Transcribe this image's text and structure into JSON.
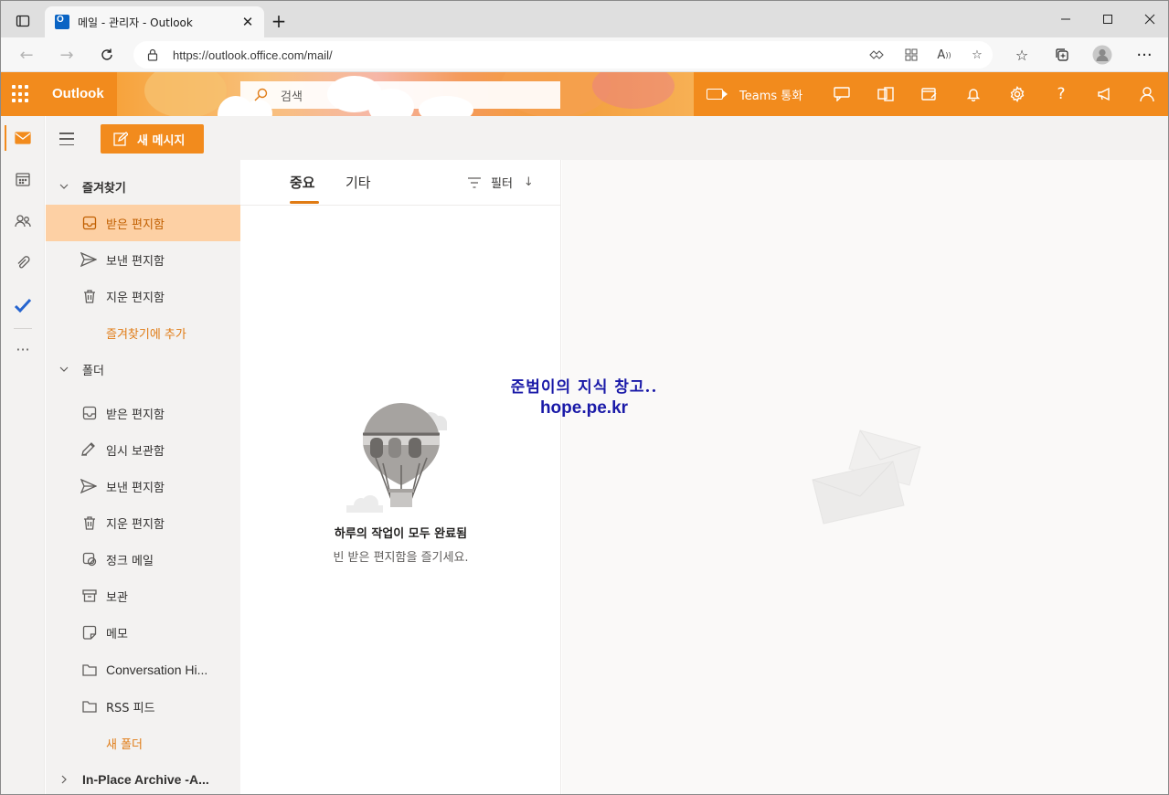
{
  "browser": {
    "tab_title": "메일 - 관리자 - Outlook",
    "url": "https://outlook.office.com/mail/"
  },
  "outlook": {
    "brand": "Outlook",
    "search_placeholder": "검색",
    "teams_label": "Teams 통화",
    "new_message_label": "새 메시지",
    "accent_color": "#f28b1d"
  },
  "folders": {
    "favorites_header": "즐겨찾기",
    "favorites": [
      {
        "label": "받은 편지함",
        "icon": "inbox-icon"
      },
      {
        "label": "보낸 편지함",
        "icon": "send-icon"
      },
      {
        "label": "지운 편지함",
        "icon": "trash-icon"
      }
    ],
    "add_favorite": "즐겨찾기에 추가",
    "folders_header": "폴더",
    "items": [
      {
        "label": "받은 편지함",
        "icon": "inbox-icon"
      },
      {
        "label": "임시 보관함",
        "icon": "draft-icon"
      },
      {
        "label": "보낸 편지함",
        "icon": "send-icon"
      },
      {
        "label": "지운 편지함",
        "icon": "trash-icon"
      },
      {
        "label": "정크 메일",
        "icon": "junk-icon"
      },
      {
        "label": "보관",
        "icon": "archive-icon"
      },
      {
        "label": "메모",
        "icon": "note-icon"
      },
      {
        "label": "Conversation Hi...",
        "icon": "folder-icon"
      },
      {
        "label": "RSS 피드",
        "icon": "folder-icon"
      }
    ],
    "new_folder": "새 폴더",
    "archive_group": "In-Place Archive -A..."
  },
  "message_list": {
    "tab_focused": "중요",
    "tab_other": "기타",
    "filter_label": "필터",
    "empty_title": "하루의 작업이 모두 완료됨",
    "empty_subtitle": "빈 받은 편지함을 즐기세요."
  },
  "watermark": {
    "line1": "준범이의 지식 창고..",
    "line2": "hope.pe.kr"
  }
}
